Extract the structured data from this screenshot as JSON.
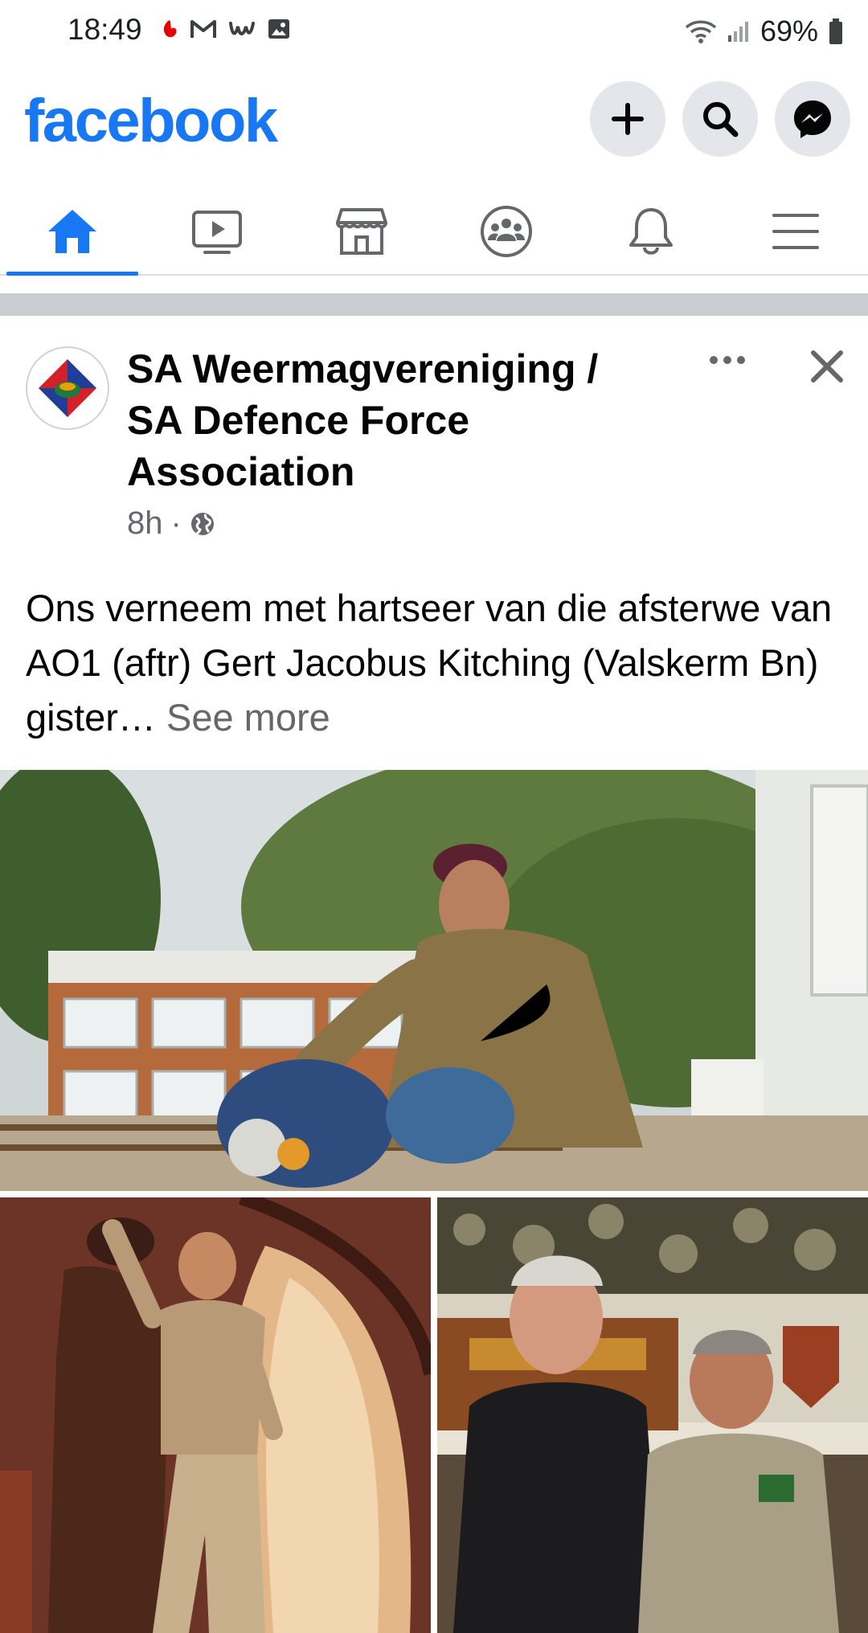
{
  "status_bar": {
    "time": "18:49",
    "battery": "69%",
    "left_icons": [
      "vodafone-icon",
      "gmail-icon",
      "w-app-icon",
      "gallery-icon"
    ],
    "right_icons": [
      "wifi-icon",
      "signal-icon",
      "battery-icon"
    ]
  },
  "header": {
    "logo": "facebook",
    "brand_color": "#1877f2",
    "buttons": [
      "plus-icon",
      "search-icon",
      "messenger-icon"
    ]
  },
  "nav": {
    "tabs": [
      {
        "name": "home",
        "icon": "home-icon",
        "active": true
      },
      {
        "name": "watch",
        "icon": "video-icon",
        "active": false
      },
      {
        "name": "marketplace",
        "icon": "marketplace-icon",
        "active": false
      },
      {
        "name": "groups",
        "icon": "groups-icon",
        "active": false
      },
      {
        "name": "notifications",
        "icon": "bell-icon",
        "active": false
      },
      {
        "name": "menu",
        "icon": "menu-icon",
        "active": false
      }
    ]
  },
  "post": {
    "author_line1": "SA Weermagvereniging /",
    "author_line2": "SA Defence Force",
    "author_line3": "Association",
    "time": "8h",
    "separator": "·",
    "privacy_icon": "globe-icon",
    "text": "Ons verneem met hartseer van die afsterwe van AO1 (aftr) Gert Jacobus Kitching (Valskerm Bn) gister… ",
    "see_more": "See more"
  }
}
